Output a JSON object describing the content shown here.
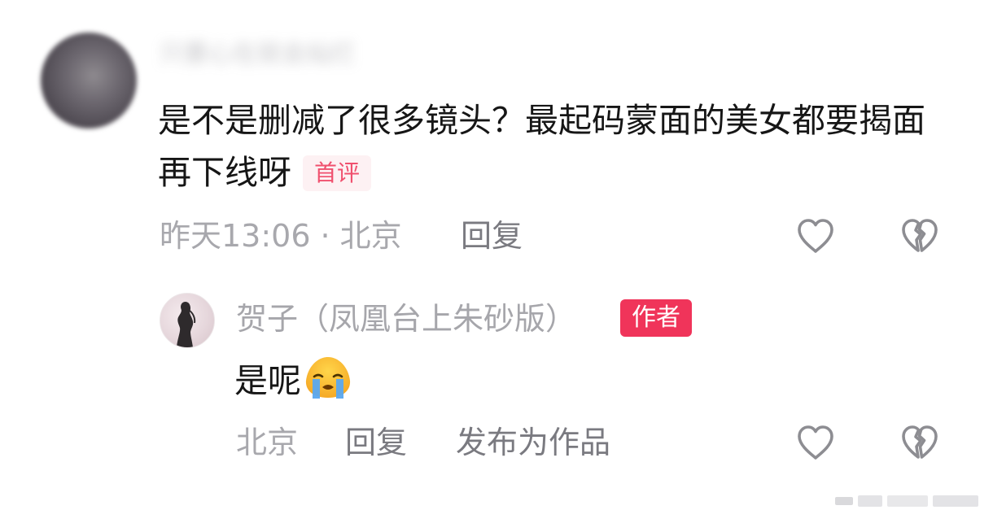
{
  "comment": {
    "author_name": "只要心在就会灿烂",
    "text": "是不是删减了很多镜头？最起码蒙面的美女都要揭面 再下线呀",
    "badge": "首评",
    "time": "昨天13:06",
    "separator": "·",
    "location": "北京",
    "reply_label": "回复",
    "like_icon": "heart-outline-icon",
    "dislike_icon": "broken-heart-icon"
  },
  "reply": {
    "author_name": "贺子（凤凰台上朱砂版）",
    "author_badge": "作者",
    "text": "是呢",
    "emoji": "crying-face-emoji",
    "location": "北京",
    "reply_label": "回复",
    "publish_label": "发布为作品",
    "like_icon": "heart-outline-icon",
    "dislike_icon": "broken-heart-icon"
  },
  "colors": {
    "badge_red": "#f0345a",
    "first_badge_text": "#f0506e",
    "muted_text": "#a8a8ad",
    "body_text": "#161616"
  }
}
